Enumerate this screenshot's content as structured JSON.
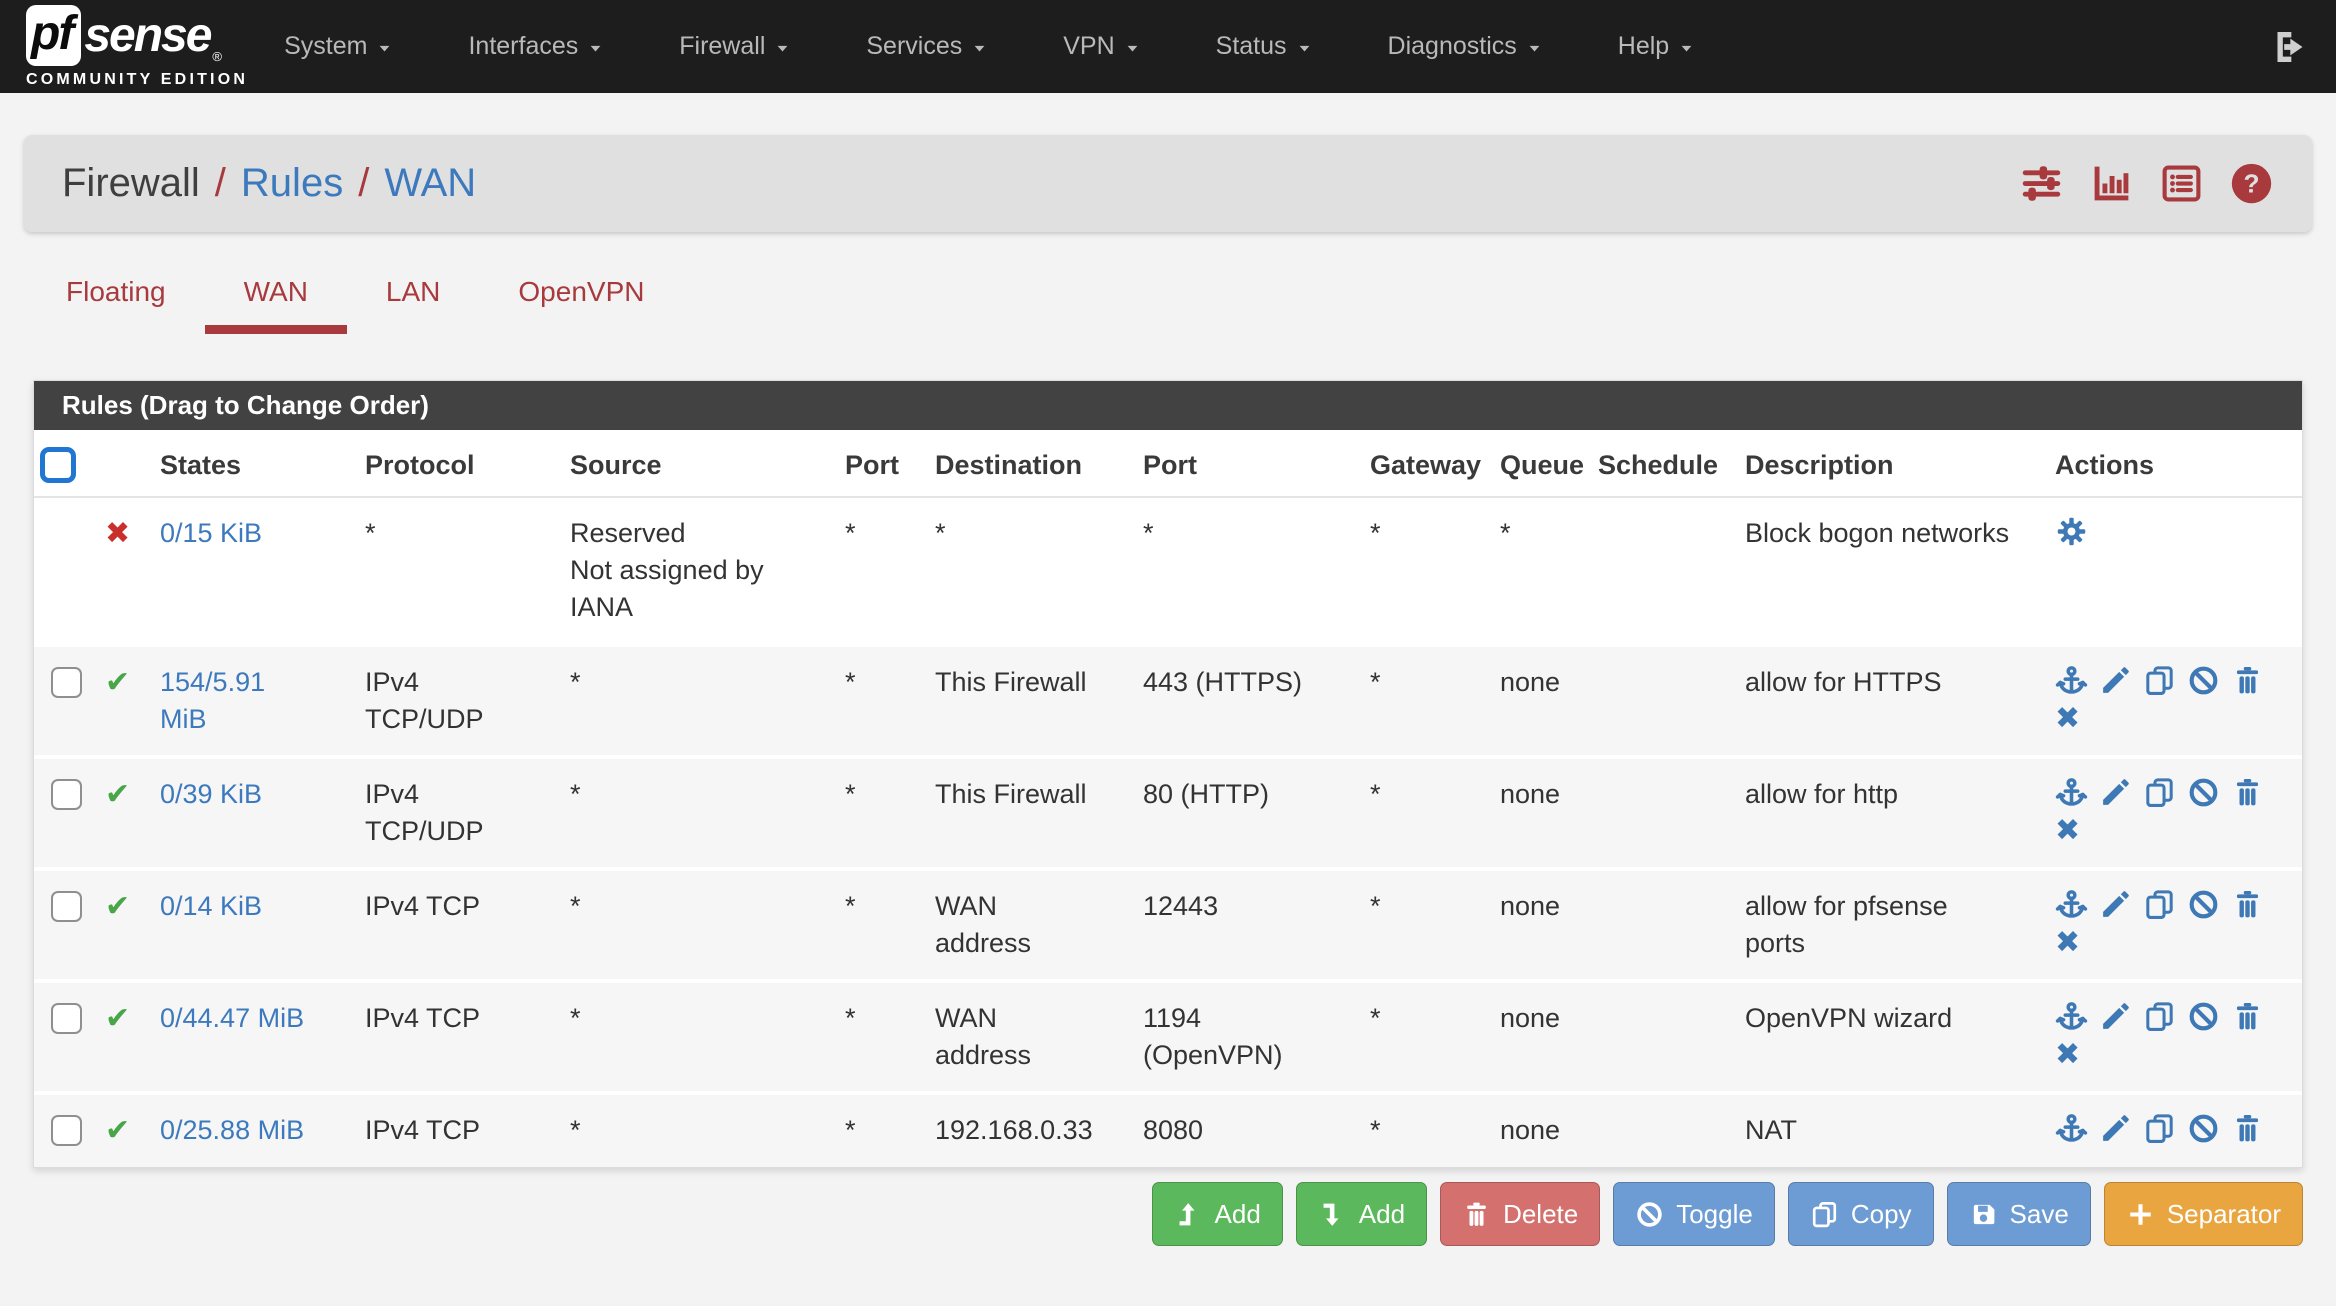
{
  "navbar": {
    "logo": {
      "pf": "pf",
      "sense": "sense",
      "reg": "®",
      "tagline": "COMMUNITY EDITION"
    },
    "items": [
      {
        "label": "System"
      },
      {
        "label": "Interfaces"
      },
      {
        "label": "Firewall"
      },
      {
        "label": "Services"
      },
      {
        "label": "VPN"
      },
      {
        "label": "Status"
      },
      {
        "label": "Diagnostics"
      },
      {
        "label": "Help"
      }
    ],
    "signout_icon": "sign-out-icon"
  },
  "breadcrumb": {
    "separator": "/",
    "items": [
      {
        "label": "Firewall",
        "link": false
      },
      {
        "label": "Rules",
        "link": true
      },
      {
        "label": "WAN",
        "link": true
      }
    ]
  },
  "header": {
    "icons": [
      "sliders-icon",
      "bar-chart-icon",
      "list-panel-icon",
      "help-icon"
    ]
  },
  "tabs": [
    {
      "label": "Floating",
      "active": false
    },
    {
      "label": "WAN",
      "active": true
    },
    {
      "label": "LAN",
      "active": false
    },
    {
      "label": "OpenVPN",
      "active": false
    }
  ],
  "panel": {
    "title": "Rules (Drag to Change Order)"
  },
  "table": {
    "columns": [
      "States",
      "Protocol",
      "Source",
      "Port",
      "Destination",
      "Port",
      "Gateway",
      "Queue",
      "Schedule",
      "Description",
      "Actions"
    ],
    "rows": [
      {
        "selectable": false,
        "status": "block",
        "states": "0/15 KiB",
        "protocol": "*",
        "source": "Reserved\nNot assigned by\nIANA",
        "source_port": "*",
        "destination": "*",
        "destination_port": "*",
        "gateway": "*",
        "queue": "*",
        "schedule": "",
        "description": "Block bogon networks",
        "actions": [
          "gear-icon"
        ]
      },
      {
        "selectable": true,
        "status": "pass",
        "states": "154/5.91\nMiB",
        "protocol": "IPv4\nTCP/UDP",
        "source": "*",
        "source_port": "*",
        "destination": "This Firewall",
        "destination_port": "443 (HTTPS)",
        "gateway": "*",
        "queue": "none",
        "schedule": "",
        "description": "allow for HTTPS",
        "actions": [
          "anchor-icon",
          "pencil-icon",
          "copy-icon",
          "ban-icon",
          "trash-icon",
          "x-icon"
        ]
      },
      {
        "selectable": true,
        "status": "pass",
        "states": "0/39 KiB",
        "protocol": "IPv4\nTCP/UDP",
        "source": "*",
        "source_port": "*",
        "destination": "This Firewall",
        "destination_port": "80 (HTTP)",
        "gateway": "*",
        "queue": "none",
        "schedule": "",
        "description": "allow for http",
        "actions": [
          "anchor-icon",
          "pencil-icon",
          "copy-icon",
          "ban-icon",
          "trash-icon",
          "x-icon"
        ]
      },
      {
        "selectable": true,
        "status": "pass",
        "states": "0/14 KiB",
        "protocol": "IPv4 TCP",
        "source": "*",
        "source_port": "*",
        "destination": "WAN\naddress",
        "destination_port": "12443",
        "gateway": "*",
        "queue": "none",
        "schedule": "",
        "description": "allow for pfsense\nports",
        "actions": [
          "anchor-icon",
          "pencil-icon",
          "copy-icon",
          "ban-icon",
          "trash-icon",
          "x-icon"
        ]
      },
      {
        "selectable": true,
        "status": "pass",
        "states": "0/44.47 MiB",
        "protocol": "IPv4 TCP",
        "source": "*",
        "source_port": "*",
        "destination": "WAN\naddress",
        "destination_port": "1194\n(OpenVPN)",
        "gateway": "*",
        "queue": "none",
        "schedule": "",
        "description": "OpenVPN wizard",
        "actions": [
          "anchor-icon",
          "pencil-icon",
          "copy-icon",
          "ban-icon",
          "trash-icon",
          "x-icon"
        ]
      },
      {
        "selectable": true,
        "status": "pass",
        "states": "0/25.88 MiB",
        "protocol": "IPv4 TCP",
        "source": "*",
        "source_port": "*",
        "destination": "192.168.0.33",
        "destination_port": "8080",
        "gateway": "*",
        "queue": "none",
        "schedule": "",
        "description": "NAT",
        "actions": [
          "anchor-icon",
          "pencil-icon",
          "copy-icon",
          "ban-icon",
          "trash-icon"
        ]
      }
    ]
  },
  "footer": {
    "buttons": [
      {
        "name": "add-rule-top",
        "label": "Add",
        "icon": "level-up-icon",
        "color": "#5cb85c"
      },
      {
        "name": "add-rule-bottom",
        "label": "Add",
        "icon": "level-down-icon",
        "color": "#5cb85c"
      },
      {
        "name": "delete",
        "label": "Delete",
        "icon": "trash-icon",
        "color": "#d4706d"
      },
      {
        "name": "toggle",
        "label": "Toggle",
        "icon": "ban-icon",
        "color": "#6d9bd3"
      },
      {
        "name": "copy",
        "label": "Copy",
        "icon": "copy-icon",
        "color": "#6d9bd3"
      },
      {
        "name": "save",
        "label": "Save",
        "icon": "save-icon",
        "color": "#6d9bd3"
      },
      {
        "name": "separator",
        "label": "Separator",
        "icon": "plus-icon",
        "color": "#e9a53f"
      }
    ]
  },
  "colors": {
    "accent_red": "#a83a3e",
    "link_blue": "#3d79bd",
    "action_icon_blue": "#3e78b5",
    "pass_green": "#4aa54a",
    "block_red": "#c9302c",
    "panel_header_bg": "#424242",
    "navbar_bg": "#1d1d1d",
    "breadcrumb_bg": "#e0e0e0"
  }
}
